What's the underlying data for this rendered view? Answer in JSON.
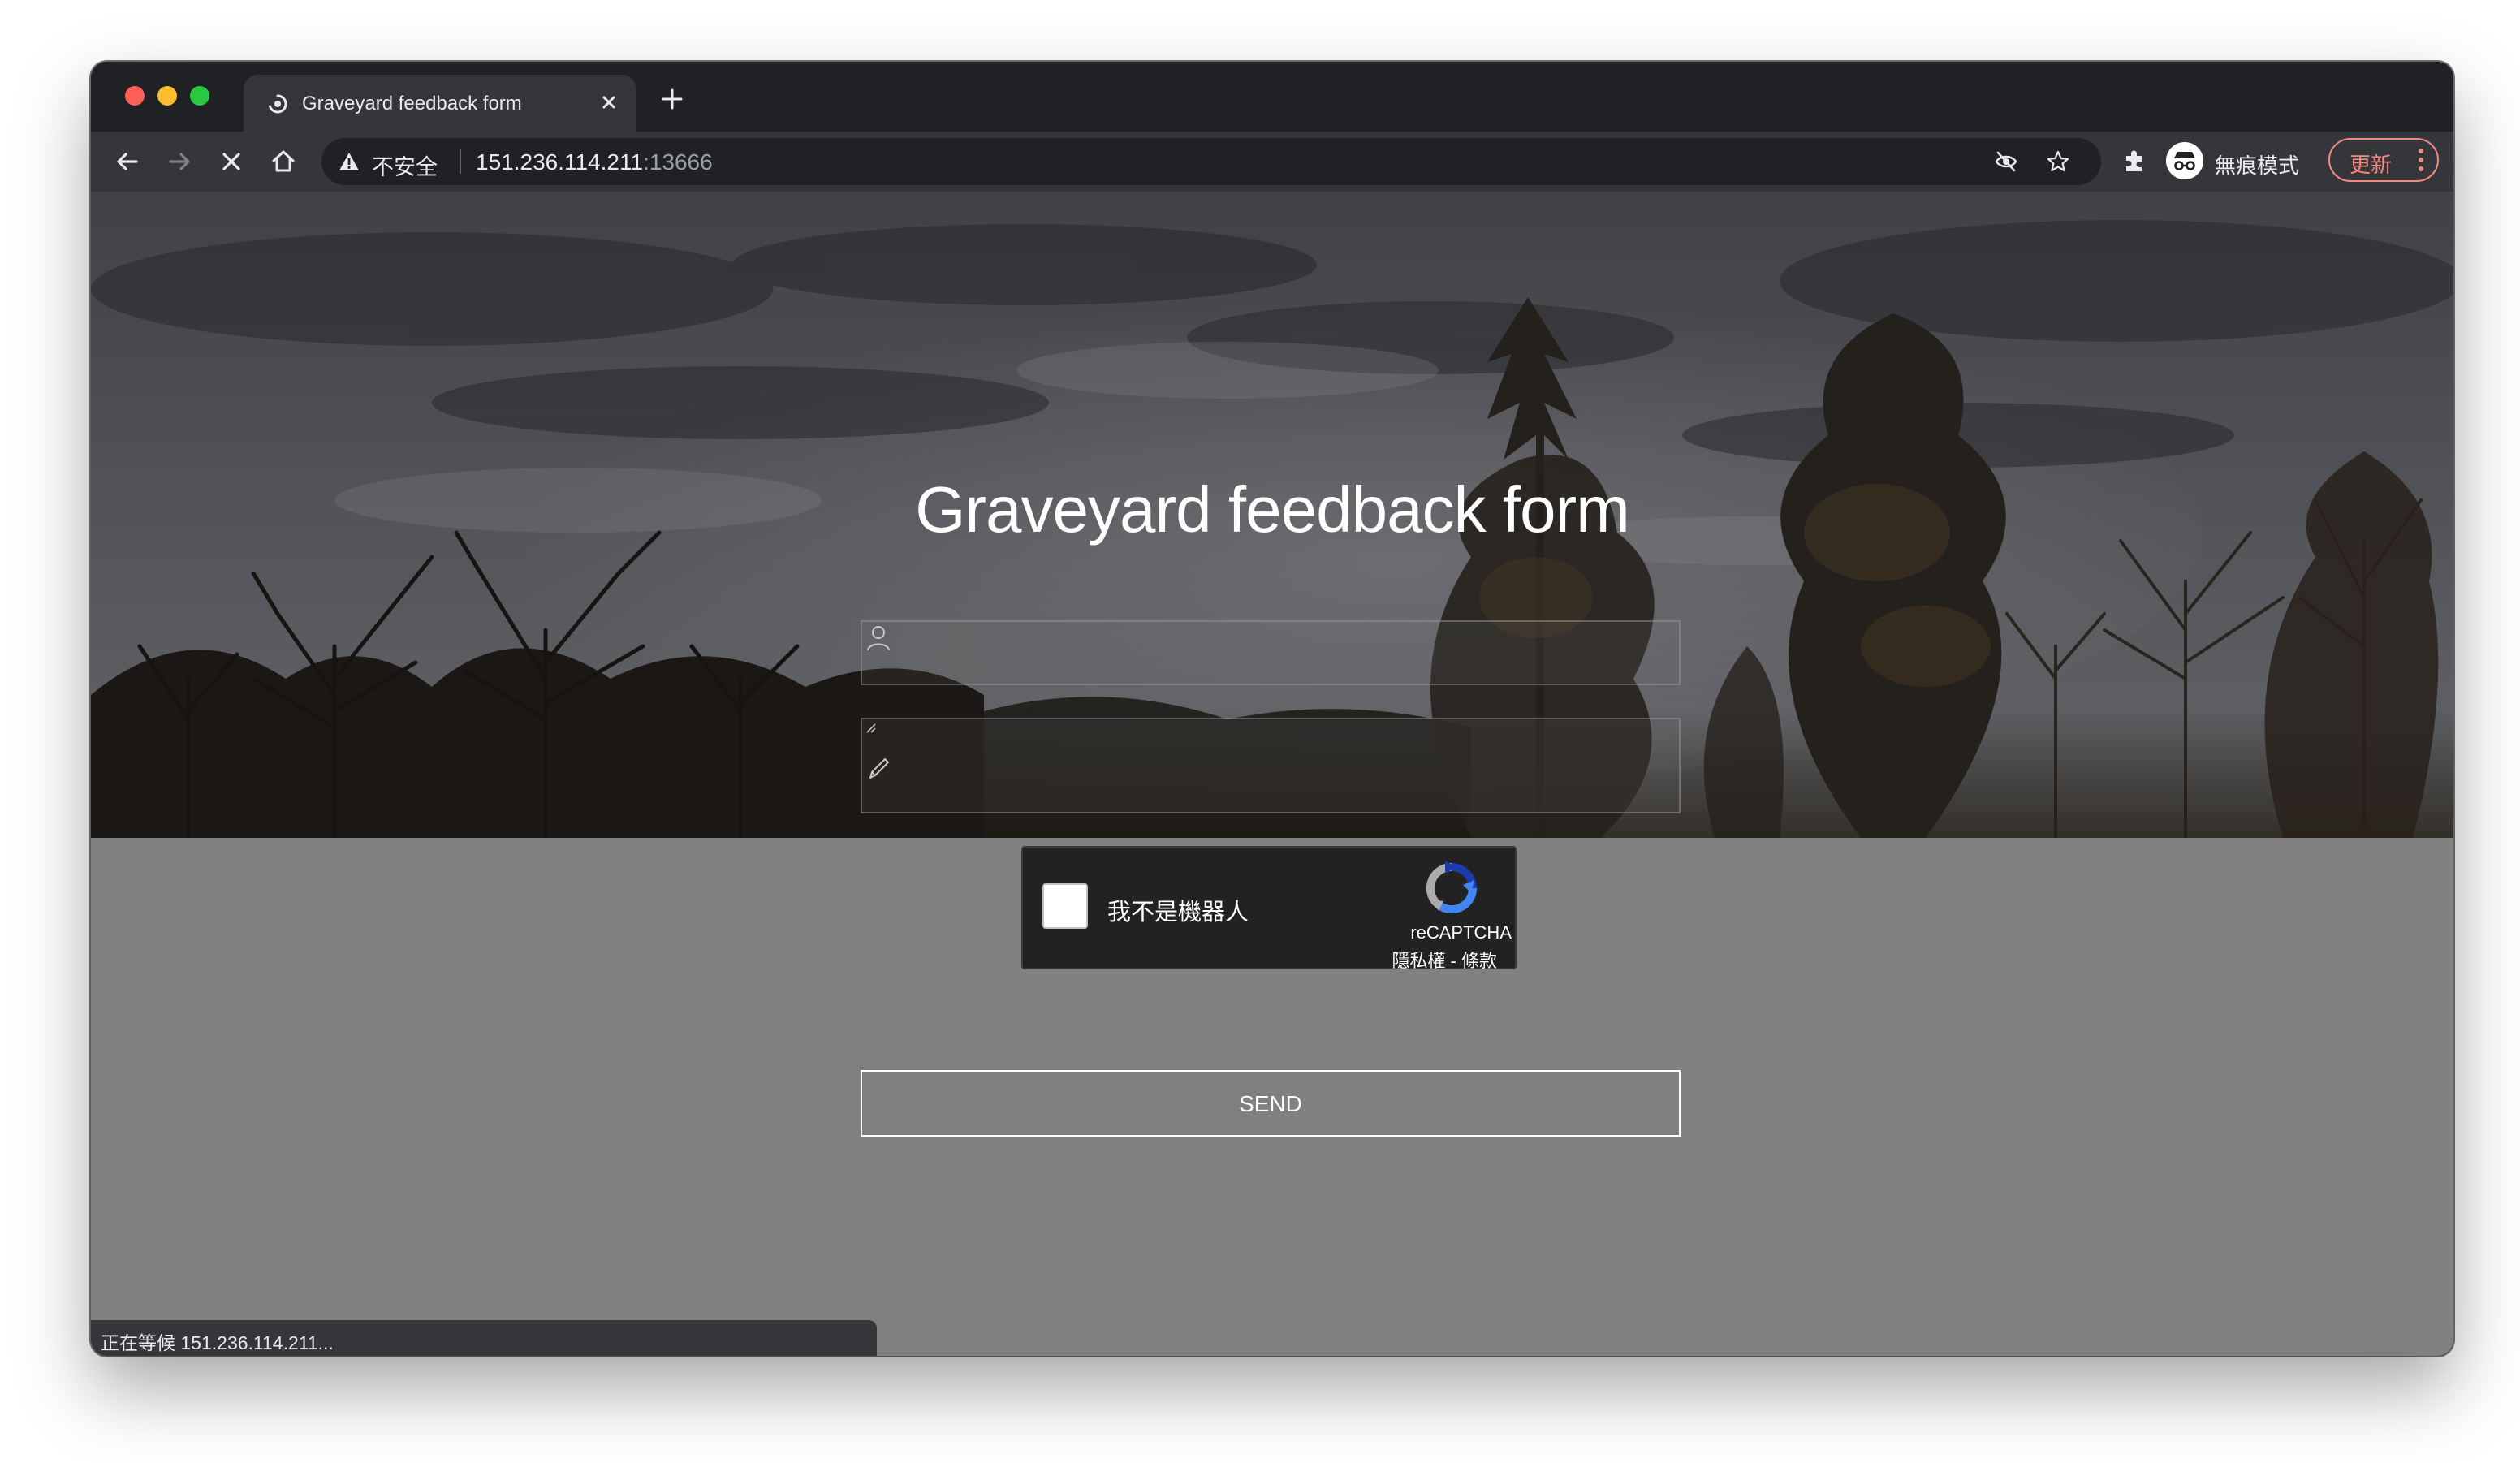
{
  "window": {
    "traffic_lights": {
      "close": "#fe5f57",
      "minimize": "#febc2e",
      "zoom": "#28c840"
    }
  },
  "tab": {
    "title": "Graveyard feedback form",
    "favicon": "loading-spinner-icon",
    "close_icon": "close-icon"
  },
  "new_tab": {
    "icon": "plus-icon",
    "label": "+"
  },
  "toolbar": {
    "back_icon": "arrow-left-icon",
    "forward_icon": "arrow-right-icon",
    "stop_icon": "stop-loading-icon",
    "home_icon": "home-icon",
    "omnibox": {
      "security_icon": "warning-triangle-icon",
      "security_text": "不安全",
      "url_host": "151.236.114.211",
      "url_port": ":13666",
      "eye_off_icon": "eye-off-icon",
      "bookmark_icon": "star-icon"
    },
    "extensions_icon": "puzzle-icon",
    "incognito": {
      "icon": "incognito-icon",
      "label": "無痕模式"
    },
    "update": {
      "label": "更新",
      "menu_icon": "kebab-menu-icon",
      "color": "#f28b82"
    }
  },
  "page": {
    "title": "Graveyard feedback form",
    "name_field": {
      "value": "",
      "placeholder": "",
      "icon": "user-icon"
    },
    "message_field": {
      "value": "",
      "placeholder": "",
      "icon": "pencil-icon"
    },
    "recaptcha": {
      "checkbox_label": "我不是機器人",
      "checked": false,
      "brand": "reCAPTCHA",
      "links": "隱私權 - 條款",
      "logo_icon": "recaptcha-logo-icon"
    },
    "send_button": {
      "label": "SEND"
    },
    "background_color": "#808080"
  },
  "status_bar": {
    "text": "正在等候 151.236.114.211..."
  }
}
